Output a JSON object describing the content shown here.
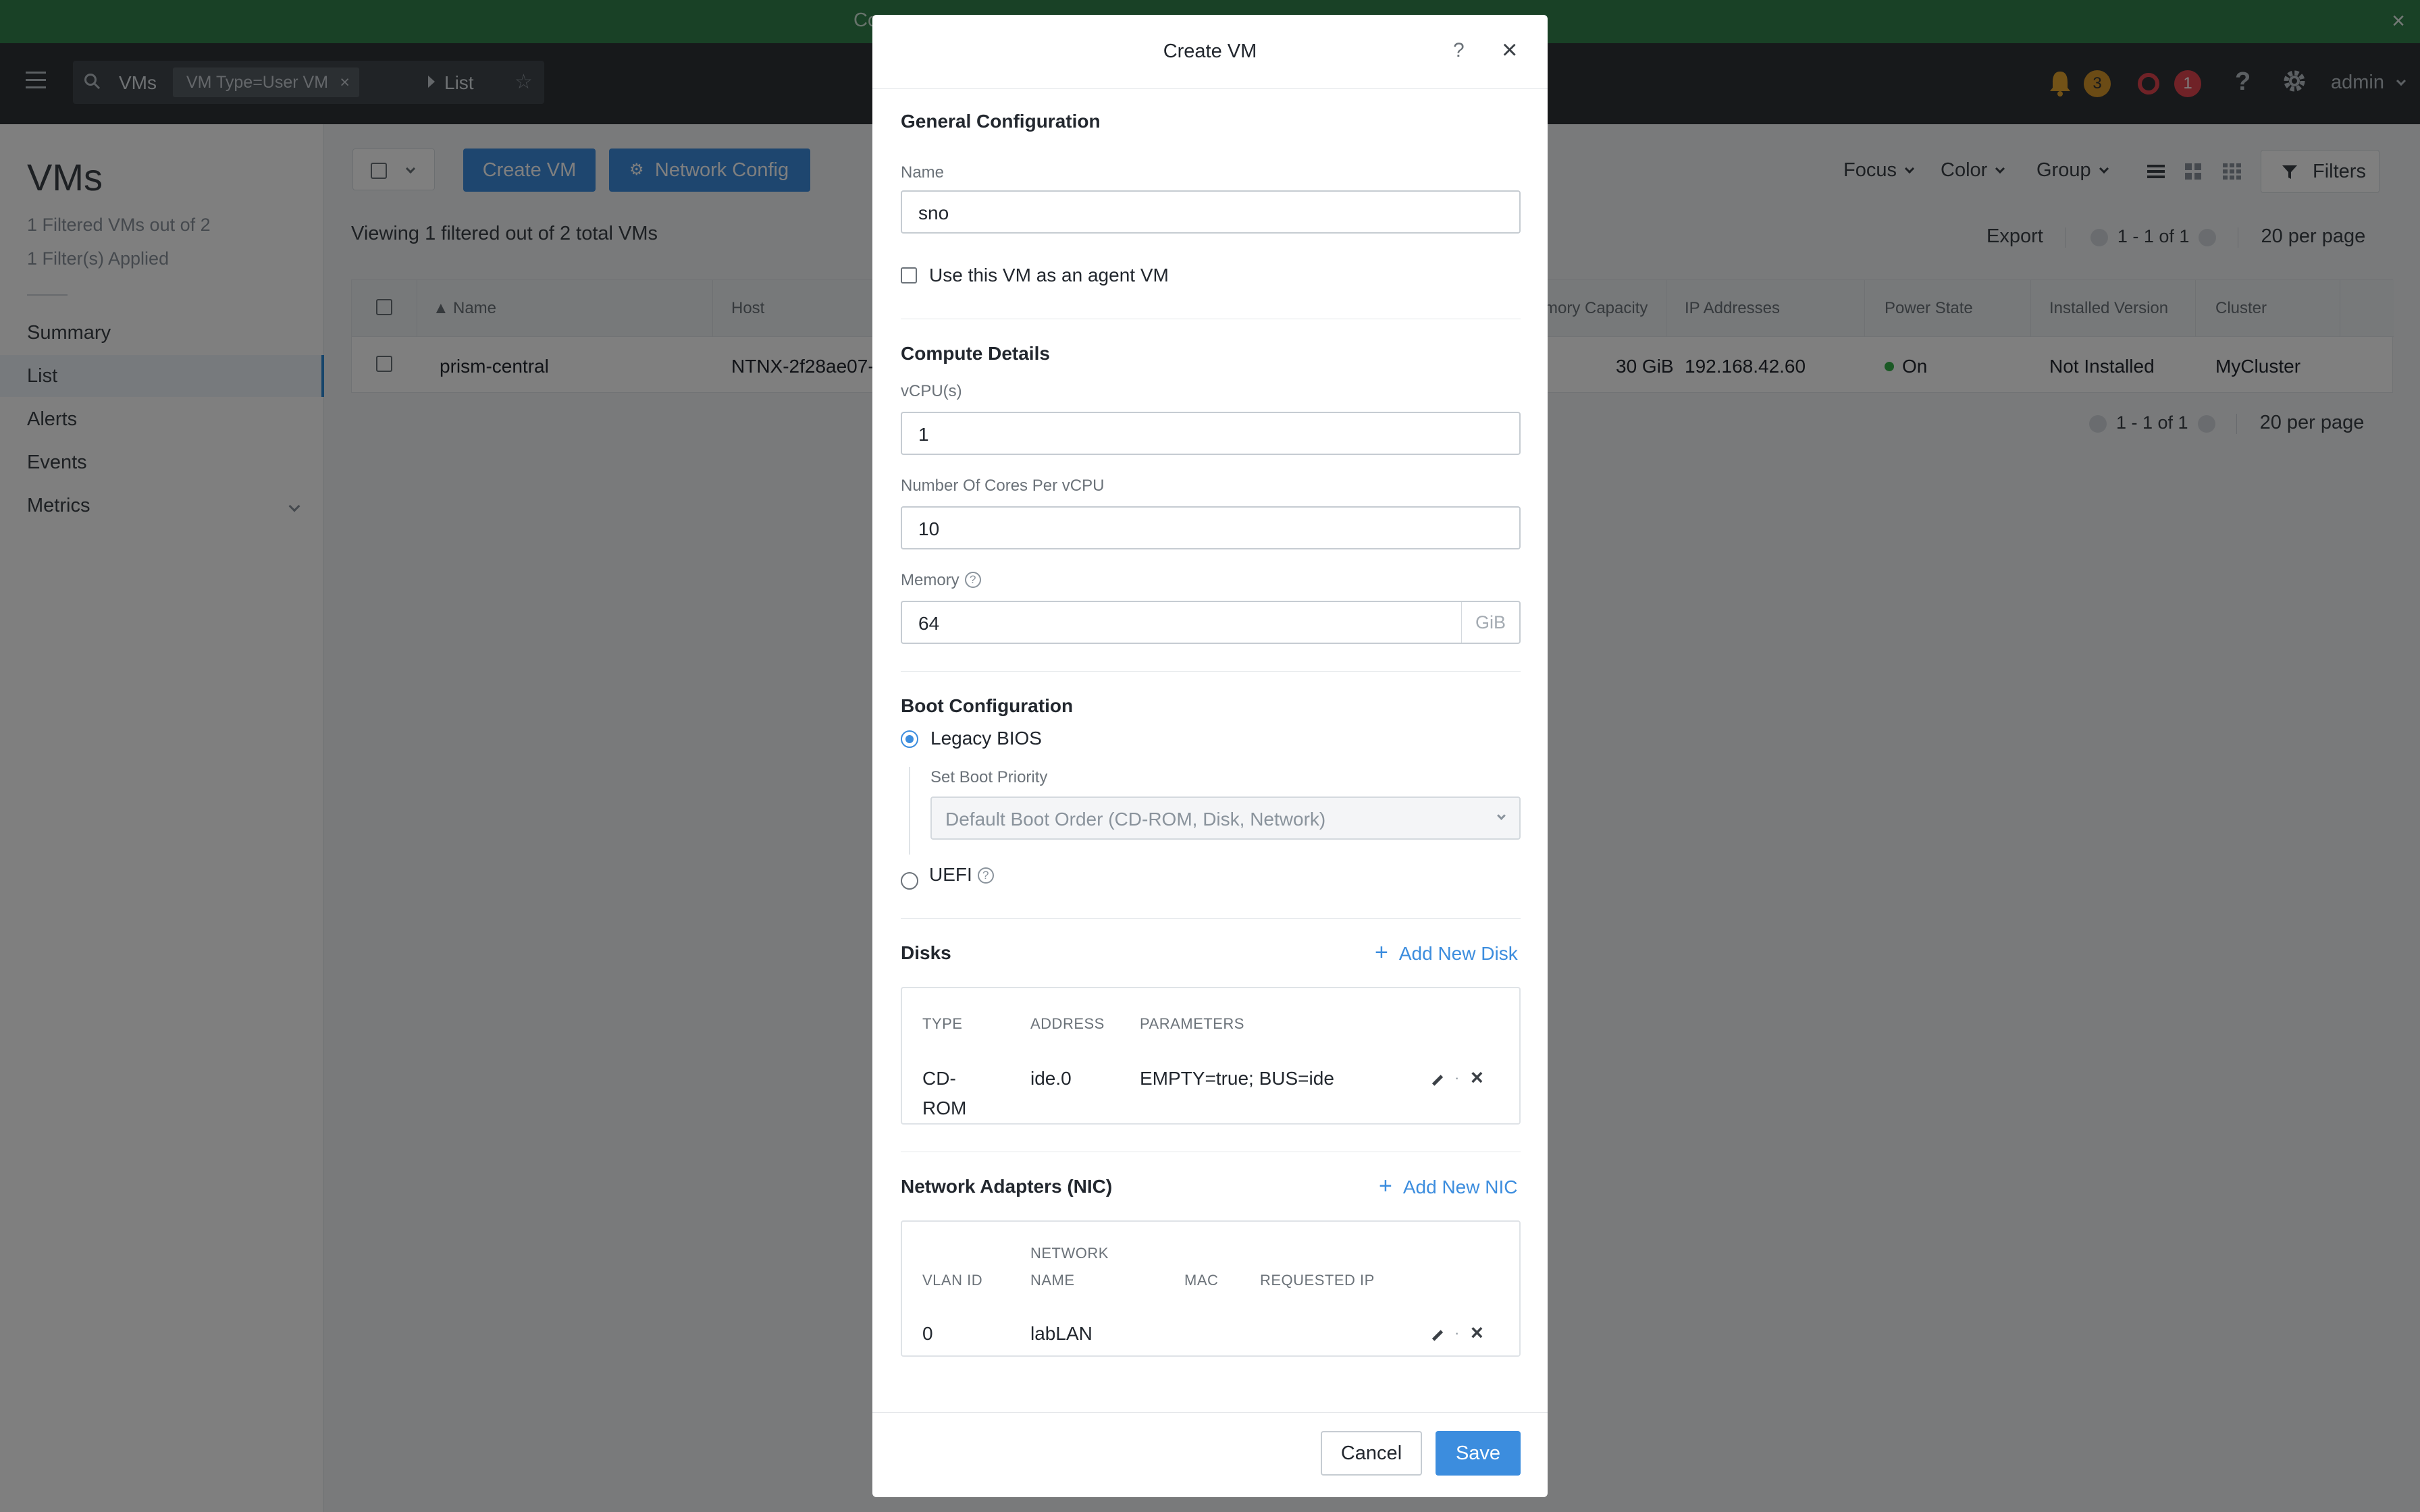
{
  "banner": {
    "text": "Co",
    "close": "×"
  },
  "header": {
    "search": {
      "entity": "VMs",
      "filter_chip": "VM Type=User VM",
      "chip_remove": "×",
      "view": "List"
    },
    "alerts_count": "3",
    "critical_count": "1",
    "help": "?",
    "user": "admin"
  },
  "sidebar": {
    "title": "VMs",
    "summary_line1": "1 Filtered VMs out of 2",
    "summary_line2": "1 Filter(s) Applied",
    "items": [
      {
        "label": "Summary"
      },
      {
        "label": "List",
        "active": true
      },
      {
        "label": "Alerts"
      },
      {
        "label": "Events"
      },
      {
        "label": "Metrics"
      }
    ]
  },
  "main": {
    "create_vm_label": "Create VM",
    "network_config_label": "Network Config",
    "viewing_text": "Viewing 1 filtered out of 2 total VMs",
    "focus_label": "Focus",
    "color_label": "Color",
    "group_label": "Group",
    "filters_label": "Filters",
    "export_label": "Export",
    "page_range": "1 - 1 of 1",
    "per_page": "20 per page",
    "table": {
      "columns": [
        "Name",
        "Host",
        "mory Capacity",
        "IP Addresses",
        "Power State",
        "Installed Version",
        "Cluster"
      ],
      "rows": [
        {
          "name": "prism-central",
          "host": "NTNX-2f28ae07-",
          "memory": "30 GiB",
          "ip": "192.168.42.60",
          "power": "On",
          "version": "Not Installed",
          "cluster": "MyCluster"
        }
      ]
    }
  },
  "modal": {
    "title": "Create VM",
    "help": "?",
    "close": "×",
    "general": {
      "heading": "General Configuration",
      "name_label": "Name",
      "name_value": "sno",
      "agent_vm_label": "Use this VM as an agent VM"
    },
    "compute": {
      "heading": "Compute Details",
      "vcpu_label": "vCPU(s)",
      "vcpu_value": "1",
      "cores_label": "Number Of Cores Per vCPU",
      "cores_value": "10",
      "memory_label": "Memory",
      "memory_value": "64",
      "memory_unit": "GiB"
    },
    "boot": {
      "heading": "Boot Configuration",
      "legacy_label": "Legacy BIOS",
      "priority_label": "Set Boot Priority",
      "priority_value": "Default Boot Order (CD-ROM, Disk, Network)",
      "uefi_label": "UEFI",
      "selected": "Legacy BIOS"
    },
    "disks": {
      "heading": "Disks",
      "add_label": "Add New Disk",
      "columns": [
        "TYPE",
        "ADDRESS",
        "PARAMETERS"
      ],
      "rows": [
        {
          "type_line1": "CD-",
          "type_line2": "ROM",
          "address": "ide.0",
          "parameters": "EMPTY=true; BUS=ide"
        }
      ]
    },
    "nics": {
      "heading": "Network Adapters (NIC)",
      "add_label": "Add New NIC",
      "columns": {
        "vlan": "VLAN ID",
        "network_line1": "NETWORK",
        "network_line2": "NAME",
        "mac": "MAC",
        "requested_ip": "REQUESTED IP"
      },
      "rows": [
        {
          "vlan": "0",
          "network": "labLAN",
          "mac": "",
          "requested_ip": ""
        }
      ]
    },
    "footer": {
      "cancel_label": "Cancel",
      "save_label": "Save"
    }
  },
  "colors": {
    "banner_green": "#33834d",
    "header_dark": "#2f3337",
    "accent_blue": "#3c8dde",
    "alert_orange": "#d7962a",
    "critical_red": "#e1454f",
    "power_on_green": "#36b24a"
  }
}
